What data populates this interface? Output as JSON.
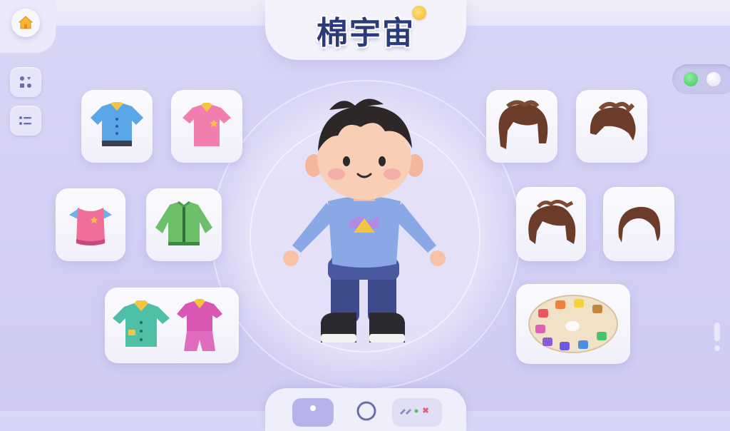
{
  "header": {
    "title": "棉宇宙"
  },
  "nav": {
    "home_icon": "home-icon",
    "side_buttons": [
      "shapes-icon",
      "list-icon"
    ]
  },
  "toggle": {
    "active": "green",
    "colors": [
      "#4cc864",
      "#ffffff"
    ]
  },
  "clothing_tiles": [
    "blue-shirt-icon",
    "pink-polo-icon",
    "pink-vest-icon",
    "green-jacket-icon",
    "outfit-set-icon"
  ],
  "hair_tiles": [
    "hair-style-1-icon",
    "hair-style-2-icon",
    "hair-style-3-icon",
    "hair-style-4-icon"
  ],
  "palette_tile": "color-palette-icon",
  "character": "avatar-figure",
  "bottom_bar": [
    "tab-outfit-icon",
    "tab-search-icon",
    "tab-decor-icon"
  ],
  "colors": {
    "accent": "#2a3a7a",
    "background": "#d6d3f5",
    "tile": "#f7f6fd"
  }
}
